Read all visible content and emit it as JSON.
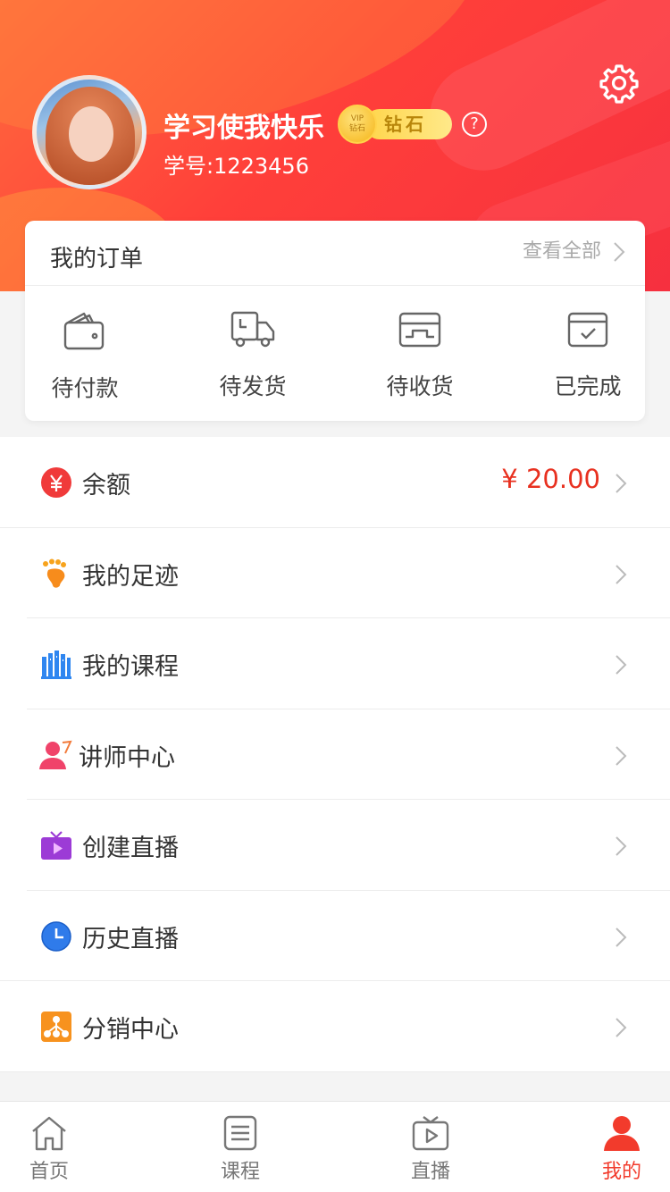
{
  "profile": {
    "name": "学习使我快乐",
    "vip_coin": "VIP\n钻石",
    "vip_level": "钻石",
    "help": "?",
    "student_id": "学号:1223456"
  },
  "orders": {
    "title": "我的订单",
    "view_all": "查看全部",
    "items": [
      {
        "label": "待付款",
        "icon": "wallet-icon"
      },
      {
        "label": "待发货",
        "icon": "truck-icon"
      },
      {
        "label": "待收货",
        "icon": "inbox-icon"
      },
      {
        "label": "已完成",
        "icon": "completed-box-icon"
      }
    ]
  },
  "menu": {
    "items": [
      {
        "label": "余额",
        "value": "¥ 20.00",
        "icon": "yuan-icon"
      },
      {
        "label": "我的足迹",
        "icon": "footprint-icon"
      },
      {
        "label": "我的课程",
        "icon": "books-icon"
      },
      {
        "label": "讲师中心",
        "icon": "teacher-icon"
      },
      {
        "label": "创建直播",
        "icon": "tv-icon"
      },
      {
        "label": "历史直播",
        "icon": "clock-icon"
      },
      {
        "label": "分销中心",
        "icon": "distribution-icon"
      }
    ]
  },
  "tabbar": {
    "items": [
      {
        "label": "首页",
        "icon": "home-icon"
      },
      {
        "label": "课程",
        "icon": "course-icon"
      },
      {
        "label": "直播",
        "icon": "live-icon"
      },
      {
        "label": "我的",
        "icon": "user-icon",
        "active": true
      }
    ]
  },
  "colors": {
    "accent": "#f23b2c",
    "price": "#e8301f",
    "vip_gold": "#ffd54a"
  }
}
